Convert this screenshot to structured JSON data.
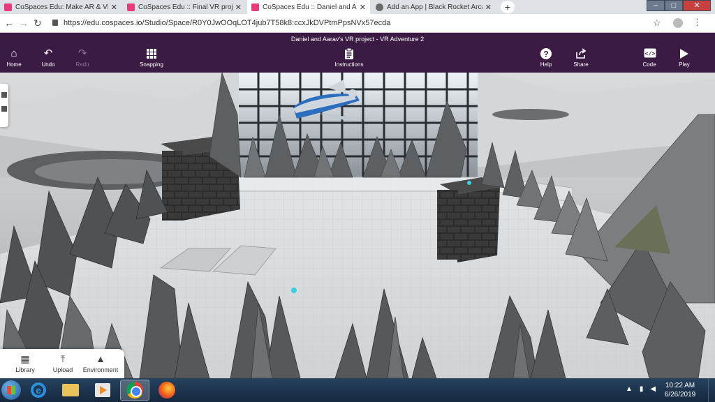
{
  "browser": {
    "tabs": [
      {
        "title": "CoSpaces Edu: Make AR & VR in",
        "icon": "cospaces-icon",
        "active": false
      },
      {
        "title": "CoSpaces Edu :: Final VR project",
        "icon": "cospaces-icon",
        "active": false
      },
      {
        "title": "CoSpaces Edu :: Daniel and Aarav",
        "icon": "cospaces-icon",
        "active": true
      },
      {
        "title": "Add an App | Black Rocket Arcad",
        "icon": "globe-icon",
        "active": false
      }
    ],
    "close_glyph": "✕",
    "new_tab_glyph": "+",
    "url": "https://edu.cospaces.io/Studio/Space/R0Y0JwOOqLOT4jub7T58k8:ccxJkDVPtmPpsNVx57ecda"
  },
  "app": {
    "title": "Daniel and Aarav's VR project - VR Adventure 2",
    "toolbar": {
      "home": "Home",
      "undo": "Undo",
      "redo": "Redo",
      "snapping": "Snapping",
      "instructions": "Instructions",
      "help": "Help",
      "share": "Share",
      "code": "Code",
      "play": "Play"
    },
    "bottom_panel": {
      "library": "Library",
      "upload": "Upload",
      "environment": "Environment"
    }
  },
  "taskbar": {
    "time": "10:22 AM",
    "date": "6/26/2019"
  }
}
